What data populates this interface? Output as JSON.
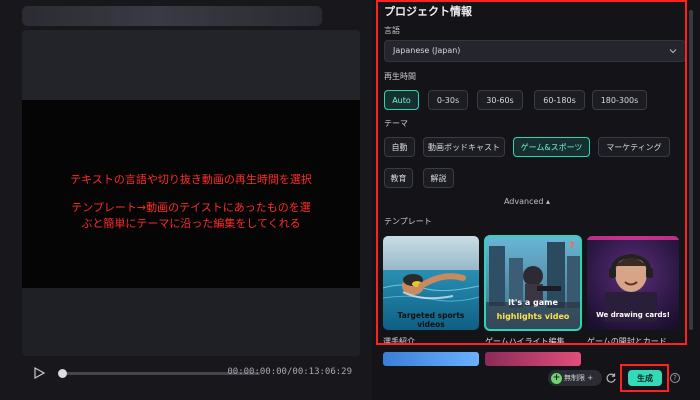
{
  "preview": {
    "annotation_line1": "テキストの言語や切り抜き動画の再生時間を選択",
    "annotation_line2": "テンプレート→動画のテイストにあったものを選",
    "annotation_line3": "ぶと簡単にテーマに沿った編集をしてくれる",
    "timecode": "00:00:00:00/00:13:06:29",
    "progress": 0.0
  },
  "panel": {
    "title": "プロジェクト情報",
    "language_label": "言語",
    "language_value": "Japanese (Japan)",
    "duration_label": "再生時間",
    "duration_options": [
      "Auto",
      "0-30s",
      "30-60s",
      "60-180s",
      "180-300s"
    ],
    "duration_selected": "Auto",
    "theme_label": "テーマ",
    "theme_options": [
      "自動",
      "動画ポッドキャスト",
      "ゲーム&スポーツ",
      "マーケティング",
      "教育",
      "解説"
    ],
    "theme_selected": "ゲーム&スポーツ",
    "advanced_label": "Advanced ▴",
    "template_label": "テンプレート",
    "templates": [
      {
        "caption": "選手紹介",
        "overlay": "Targeted sports videos"
      },
      {
        "caption": "ゲームハイライト編集...",
        "overlay_line1": "It's a game",
        "overlay_line2": "highlights video"
      },
      {
        "caption": "ゲームの開封とカード...",
        "overlay": "We drawing cards!"
      }
    ]
  },
  "footer": {
    "pill_label": "無制限 +",
    "generate_label": "生成",
    "help_label": "?"
  },
  "colors": {
    "accent": "#2fd4b8",
    "annotation": "#ff2b2b",
    "highlight_box": "#ff2020"
  }
}
